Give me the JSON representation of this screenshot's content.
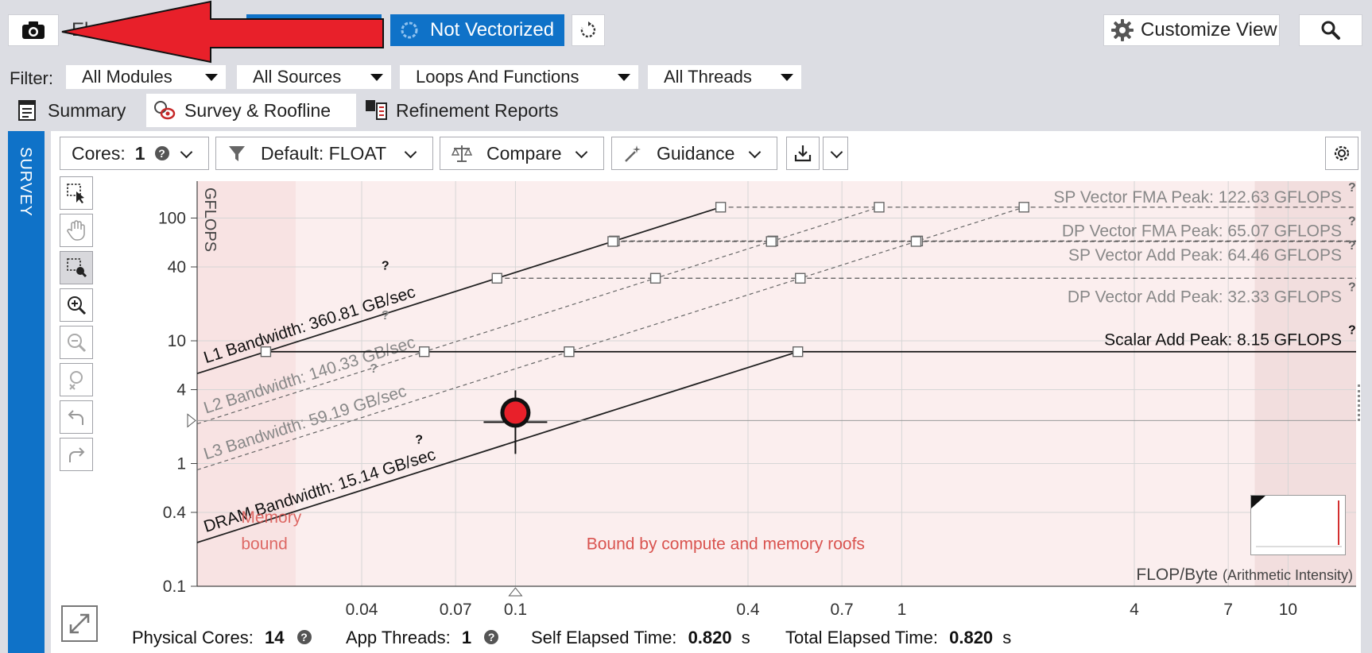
{
  "toolbar": {
    "camera_icon": "camera-icon",
    "elapsed_partial": "El",
    "vectorized_partial": "zed",
    "not_vectorized_label": "Not Vectorized",
    "customize_view_label": "Customize View",
    "search_icon": "search-icon",
    "colors": {
      "accent_blue": "#0f72c8",
      "arrow_red": "#e8202a"
    }
  },
  "filter": {
    "label": "Filter:",
    "modules": "All Modules",
    "sources": "All Sources",
    "loops": "Loops And Functions",
    "threads": "All Threads"
  },
  "tabs": [
    {
      "label": "Summary",
      "icon": "summary-icon"
    },
    {
      "label": "Survey & Roofline",
      "icon": "survey-roofline-icon"
    },
    {
      "label": "Refinement Reports",
      "icon": "refinement-reports-icon"
    }
  ],
  "sidebar": {
    "label": "SURVEY"
  },
  "controls": {
    "cores_label": "Cores:",
    "cores_value": "1",
    "filter_value": "Default: FLOAT",
    "compare_label": "Compare",
    "guidance_label": "Guidance"
  },
  "chart_data": {
    "type": "scatter",
    "scale": "log-log",
    "ylabel": "GFLOPS",
    "xlabel_main": "FLOP/Byte",
    "xlabel_sub": "(Arithmetic Intensity)",
    "xlim": [
      0.015,
      15
    ],
    "ylim": [
      0.1,
      200
    ],
    "x_ticks": [
      "0.04",
      "0.07",
      "0.1",
      "0.4",
      "0.7",
      "1",
      "4",
      "7",
      "10"
    ],
    "y_ticks": [
      "100",
      "40",
      "10",
      "4",
      "1",
      "0.4",
      "0.1"
    ],
    "compute_roofs": [
      {
        "name": "SP Vector FMA Peak: 122.63 GFLOPS",
        "value": 122.63
      },
      {
        "name": "DP Vector FMA Peak: 65.07 GFLOPS",
        "value": 65.07
      },
      {
        "name": "SP Vector Add Peak: 64.46 GFLOPS",
        "value": 64.46
      },
      {
        "name": "DP Vector Add Peak: 32.33 GFLOPS",
        "value": 32.33
      },
      {
        "name": "Scalar Add Peak: 8.15 GFLOPS",
        "value": 8.15
      }
    ],
    "memory_roofs": [
      {
        "name": "L1 Bandwidth: 360.81 GB/sec",
        "value": 360.81
      },
      {
        "name": "L2 Bandwidth: 140.33 GB/sec",
        "value": 140.33
      },
      {
        "name": "L3 Bandwidth: 59.19 GB/sec",
        "value": 59.19
      },
      {
        "name": "DRAM Bandwidth: 15.14 GB/sec",
        "value": 15.14
      }
    ],
    "points": [
      {
        "x": 0.1,
        "y": 2.6,
        "color": "#e8202a"
      }
    ],
    "regions": {
      "memory_bound": "Memory bound",
      "compute_memory": "Bound by compute and memory roofs",
      "compute_bound_partial": "bound"
    }
  },
  "footer": {
    "physical_cores_label": "Physical Cores:",
    "physical_cores_value": "14",
    "app_threads_label": "App Threads:",
    "app_threads_value": "1",
    "self_elapsed_label": "Self Elapsed Time:",
    "self_elapsed_value": "0.820",
    "total_elapsed_label": "Total Elapsed Time:",
    "total_elapsed_value": "0.820",
    "unit_seconds": "s"
  }
}
